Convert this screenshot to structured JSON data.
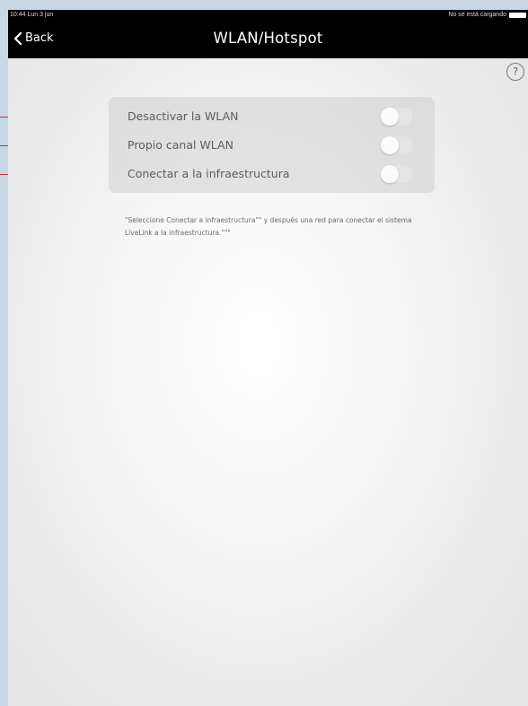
{
  "status_bar": {
    "time": "10:44  Lun 3 jun",
    "charging": "No se está cargando"
  },
  "nav": {
    "back_label": "Back",
    "title": "WLAN/Hotspot"
  },
  "help_button": {
    "label": "?"
  },
  "settings": [
    {
      "label": "Desactivar la WLAN",
      "enabled": false
    },
    {
      "label": "Propio canal WLAN",
      "enabled": false
    },
    {
      "label": "Conectar a la infraestructura",
      "enabled": false
    }
  ],
  "help_text": "\"Seleccione Conectar a infraestructura\"\" y después una red para conectar el sistema LiveLink a la infraestructura.\"\"\"",
  "colors": {
    "callout": "#c4313a",
    "navbar": "#000000",
    "frame": "#c8d7e4"
  }
}
